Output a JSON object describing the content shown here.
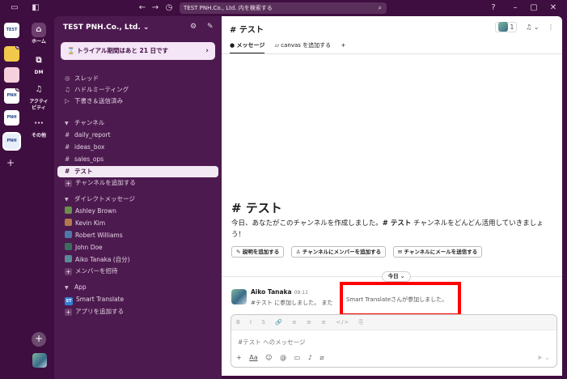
{
  "titlebar": {
    "search_text": "TEST PNH.Co., Ltd. 内を検索する",
    "icons": [
      "sidebar-icon",
      "back-arrow-icon",
      "forward-arrow-icon",
      "history-icon",
      "search-icon",
      "help-icon",
      "minimize-icon",
      "maximize-icon",
      "close-icon"
    ]
  },
  "rail": {
    "workspaces": [
      {
        "label": "TEST",
        "color": "#2a4a8a"
      },
      {
        "label": "",
        "color": "#e8b73a"
      },
      {
        "label": "",
        "color": "#d44d7a"
      },
      {
        "label": "PNH",
        "color": "#2a4a8a"
      },
      {
        "label": "PNH",
        "color": "#2a4a8a"
      },
      {
        "label": "PNH",
        "color": "#2a4a8a"
      }
    ],
    "add_label": "+"
  },
  "nav": {
    "items": [
      {
        "label": "ホーム",
        "icon": "home-icon"
      },
      {
        "label": "DM",
        "icon": "dm-icon"
      },
      {
        "label": "アクティビティ",
        "icon": "bell-icon"
      },
      {
        "label": "その他",
        "icon": "more-icon"
      }
    ],
    "add": "+"
  },
  "sidebar": {
    "workspace_name": "TEST PNH.Co., Ltd.",
    "workspace_caret": "⌄",
    "trial_text": "トライアル期間はあと 21 日です",
    "top_items": [
      {
        "label": "スレッド"
      },
      {
        "label": "ハドルミーティング"
      },
      {
        "label": "下書き＆送信済み"
      }
    ],
    "channels_header": "チャンネル",
    "channels": [
      {
        "label": "daily_report"
      },
      {
        "label": "ideas_box"
      },
      {
        "label": "sales_ops"
      },
      {
        "label": "テスト"
      }
    ],
    "add_channel": "チャンネルを追加する",
    "dm_header": "ダイレクトメッセージ",
    "dms": [
      {
        "label": "Ashley Brown",
        "color": "#6a8f4e"
      },
      {
        "label": "Kevin Kim",
        "color": "#b07a4a"
      },
      {
        "label": "Robert Williams",
        "color": "#4d7aa8"
      },
      {
        "label": "John Doe",
        "color": "#3c6e5e"
      },
      {
        "label": "Aiko Tanaka  (自分)",
        "color": "#5b8a9a"
      }
    ],
    "invite_member": "メンバーを招待",
    "app_header": "App",
    "apps": [
      {
        "label": "Smart Translate",
        "badge": "ST"
      }
    ],
    "add_app": "アプリを追加する"
  },
  "main": {
    "channel_title": "# テスト",
    "member_count": "1",
    "tabs": [
      {
        "label": "メッセージ"
      },
      {
        "label": "canvas を追加する"
      },
      {
        "label": "+"
      }
    ],
    "intro_title": "# テスト",
    "intro_prefix": "今日、あなたがこのチャンネルを作成しました。",
    "intro_channel": "# テスト",
    "intro_suffix": " チャンネルをどんどん活用していきましょう！",
    "buttons": [
      {
        "label": "✎ 説明を追加する"
      },
      {
        "label": "♙ チャンネルにメンバーを追加する"
      },
      {
        "label": "✉ チャンネルにメールを送信する"
      }
    ],
    "today_label": "今日 ⌄",
    "message": {
      "author": "Aiko Tanaka",
      "time": "09:11",
      "text": "#テスト に参加しました。 また",
      "highlight_text": "Smart Translateさんが参加しました。"
    },
    "composer": {
      "format_items": [
        "B",
        "I",
        "S",
        "🔗",
        "≡",
        "≡",
        "≡",
        "</>",
        "⎘"
      ],
      "placeholder": "#テスト へのメッセージ",
      "bottom_items": [
        "+",
        "Aa",
        "☺",
        "@",
        "▭",
        "♪",
        "⧄"
      ],
      "send": "➤ ⌄"
    }
  }
}
